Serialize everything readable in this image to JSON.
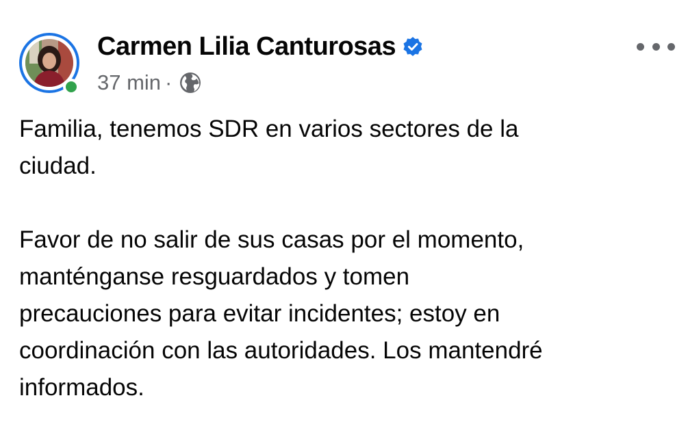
{
  "post": {
    "author": "Carmen Lilia Canturosas",
    "verified_icon": "verified-badge-icon",
    "timestamp": "37 min",
    "separator": "·",
    "audience_icon": "globe-icon",
    "more_icon": "more-options-icon",
    "paragraphs": [
      "Familia, tenemos SDR en varios sectores de la\nciudad.",
      "Favor de no salir de sus casas por el momento,\nmanténganse resguardados y tomen\nprecauciones para evitar incidentes; estoy en\ncoordinación con las autoridades. Los mantendré\ninformados."
    ]
  },
  "colors": {
    "accent": "#1b74e4",
    "online": "#31a24c",
    "secondary_text": "#65676b",
    "text": "#050505"
  }
}
